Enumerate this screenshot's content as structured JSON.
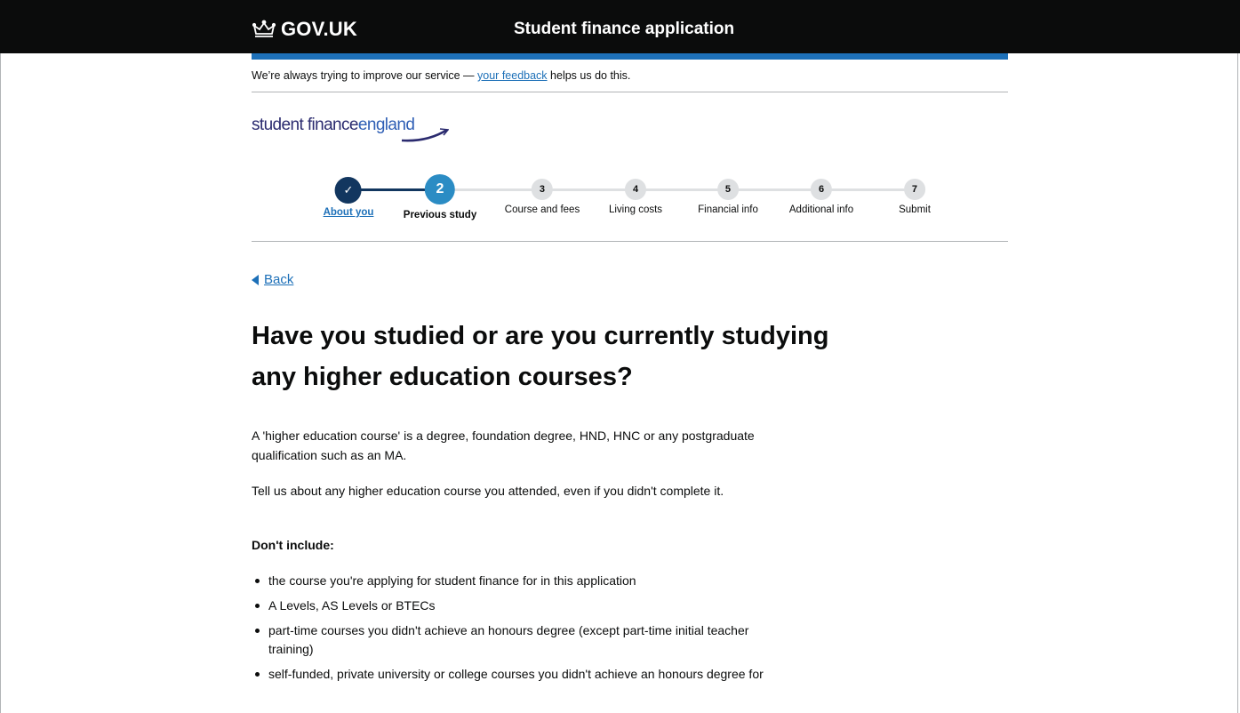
{
  "header": {
    "logo_text": "GOV.UK",
    "service_name": "Student finance application"
  },
  "banner": {
    "text_before": "We’re always trying to improve our service — ",
    "link_text": "your feedback",
    "text_after": " helps us do this."
  },
  "brand": {
    "part1": "student",
    "part2": "finance",
    "part3": "england"
  },
  "progress": {
    "current_step": 2,
    "steps": [
      {
        "number": "✓",
        "label": "About you",
        "state": "completed"
      },
      {
        "number": "2",
        "label": "Previous study",
        "state": "current"
      },
      {
        "number": "3",
        "label": "Course and fees",
        "state": "upcoming"
      },
      {
        "number": "4",
        "label": "Living costs",
        "state": "upcoming"
      },
      {
        "number": "5",
        "label": "Financial info",
        "state": "upcoming"
      },
      {
        "number": "6",
        "label": "Additional info",
        "state": "upcoming"
      },
      {
        "number": "7",
        "label": "Submit",
        "state": "upcoming"
      }
    ]
  },
  "back_link": "Back",
  "page": {
    "heading": "Have you studied or are you currently studying any higher education courses?",
    "para1": "A 'higher education course' is a degree, foundation degree, HND, HNC or any postgraduate qualification such as an MA.",
    "para2": "Tell us about any higher education course you attended, even if you didn't complete it.",
    "dont_include_heading": "Don't include:",
    "dont_include_items": [
      "the course you're applying for student finance for in this application",
      "A Levels, AS Levels or BTECs",
      "part-time courses you didn't achieve an honours degree (except part-time initial teacher training)",
      "self-funded, private university or college courses you didn't achieve an honours degree for"
    ]
  },
  "colors": {
    "header_bg": "#0b0c0c",
    "brand_blue": "#1d70b8",
    "completed_step": "#12365f",
    "current_step": "#2b8cc4",
    "upcoming_step": "#dee0e2"
  }
}
